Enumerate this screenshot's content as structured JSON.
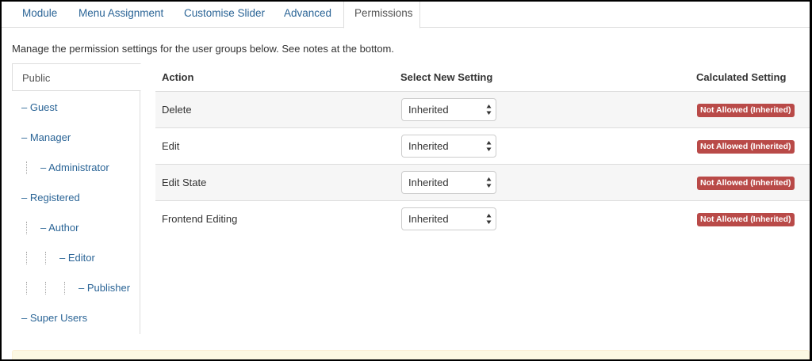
{
  "tabs": [
    {
      "label": "Module",
      "active": false
    },
    {
      "label": "Menu Assignment",
      "active": false
    },
    {
      "label": "Customise Slider",
      "active": false
    },
    {
      "label": "Advanced",
      "active": false
    },
    {
      "label": "Permissions",
      "active": true
    }
  ],
  "intro": "Manage the permission settings for the user groups below. See notes at the bottom.",
  "groups": [
    {
      "label": "Public"
    },
    {
      "label": "– Guest"
    },
    {
      "label": "– Manager"
    },
    {
      "label": "– Administrator"
    },
    {
      "label": "– Registered"
    },
    {
      "label": "– Author"
    },
    {
      "label": "– Editor"
    },
    {
      "label": "– Publisher"
    },
    {
      "label": "– Super Users"
    }
  ],
  "table": {
    "headers": {
      "action": "Action",
      "select": "Select New Setting",
      "calculated": "Calculated Setting"
    },
    "rows": [
      {
        "action": "Delete",
        "setting": "Inherited",
        "calculated": "Not Allowed (Inherited)"
      },
      {
        "action": "Edit",
        "setting": "Inherited",
        "calculated": "Not Allowed (Inherited)"
      },
      {
        "action": "Edit State",
        "setting": "Inherited",
        "calculated": "Not Allowed (Inherited)"
      },
      {
        "action": "Frontend Editing",
        "setting": "Inherited",
        "calculated": "Not Allowed (Inherited)"
      }
    ]
  },
  "colors": {
    "link": "#2a6496",
    "badge": "#b94a48",
    "row_stripe": "#f6f6f6",
    "notes_bg": "#fcf8e3"
  }
}
